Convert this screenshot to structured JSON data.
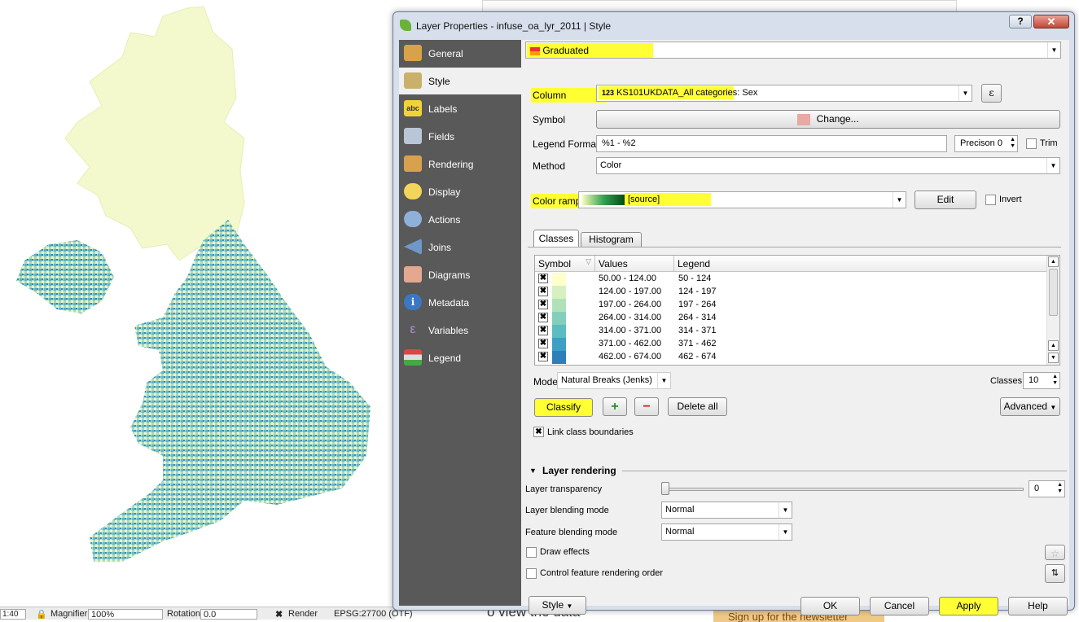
{
  "statusbar": {
    "scale_value": "1:40",
    "magnifier_label": "Magnifier",
    "magnifier_value": "100%",
    "rotation_label": "Rotation",
    "rotation_value": "0.0",
    "render_label": "Render",
    "crs": "EPSG:27700 (OTF)"
  },
  "background": {
    "text1": "o view the data",
    "text2": "Sign up for the newsletter"
  },
  "dialog": {
    "title": "Layer Properties - infuse_oa_lyr_2011 | Style",
    "help": "?",
    "close": "✕"
  },
  "sidebar": {
    "items": [
      {
        "label": "General",
        "icon": "wrench-hammer-icon",
        "color": "#d8a24a"
      },
      {
        "label": "Style",
        "icon": "paintbrush-icon",
        "color": "#c9b16b"
      },
      {
        "label": "Labels",
        "icon": "abc-label-icon",
        "color": "#f1d23a"
      },
      {
        "label": "Fields",
        "icon": "table-icon",
        "color": "#b8c6d6"
      },
      {
        "label": "Rendering",
        "icon": "brush-icon",
        "color": "#d8a14e"
      },
      {
        "label": "Display",
        "icon": "speech-bubble-icon",
        "color": "#f4d55b"
      },
      {
        "label": "Actions",
        "icon": "gear-play-icon",
        "color": "#8fb0d8"
      },
      {
        "label": "Joins",
        "icon": "join-arrow-icon",
        "color": "#6f97c9"
      },
      {
        "label": "Diagrams",
        "icon": "diagram-icon",
        "color": "#e4a78f"
      },
      {
        "label": "Metadata",
        "icon": "info-icon",
        "color": "#3a78c4"
      },
      {
        "label": "Variables",
        "icon": "epsilon-icon",
        "color": "#8b5aa5"
      },
      {
        "label": "Legend",
        "icon": "legend-icon",
        "color": "#73a93f"
      }
    ]
  },
  "style": {
    "renderer": "Graduated",
    "column_label": "Column",
    "column_value": "KS101UKDATA_All categories: Sex",
    "column_type": "123",
    "expression_btn": "ε",
    "symbol_label": "Symbol",
    "symbol_change": "Change...",
    "symbol_color": "#e8a8a4",
    "legend_format_label": "Legend Format",
    "legend_format_value": "%1 - %2",
    "precision": "Precison 0",
    "trim": "Trim",
    "method_label": "Method",
    "method_value": "Color",
    "color_ramp_label": "Color ramp",
    "color_ramp_value": "[source]",
    "edit": "Edit",
    "invert": "Invert",
    "tabs": [
      "Classes",
      "Histogram"
    ],
    "table_headers": [
      "Symbol",
      "Values",
      "Legend"
    ],
    "classes": [
      {
        "values": "50.00 - 124.00",
        "legend": "50 - 124",
        "color": "#ffffcc"
      },
      {
        "values": "124.00 - 197.00",
        "legend": "124 - 197",
        "color": "#d7f0c2"
      },
      {
        "values": "197.00 - 264.00",
        "legend": "197 - 264",
        "color": "#b2e1b9"
      },
      {
        "values": "264.00 - 314.00",
        "legend": "264 - 314",
        "color": "#83cfbb"
      },
      {
        "values": "314.00 - 371.00",
        "legend": "314 - 371",
        "color": "#5bbcc2"
      },
      {
        "values": "371.00 - 462.00",
        "legend": "371 - 462",
        "color": "#3b9fc6"
      },
      {
        "values": "462.00 - 674.00",
        "legend": "462 - 674",
        "color": "#2c7fb8"
      }
    ],
    "mode_label": "Mode",
    "mode_value": "Natural Breaks (Jenks)",
    "classes_label": "Classes",
    "classes_count": "10",
    "classify": "Classify",
    "add_icon": "+",
    "remove_icon": "−",
    "delete_all": "Delete all",
    "advanced": "Advanced",
    "link_boundaries": "Link class boundaries"
  },
  "layer_rendering": {
    "header": "Layer rendering",
    "transparency_label": "Layer transparency",
    "transparency_value": "0",
    "blending_label": "Layer blending mode",
    "blending_value": "Normal",
    "feature_blending_label": "Feature blending mode",
    "feature_blending_value": "Normal",
    "draw_effects": "Draw effects",
    "control_order": "Control feature rendering order"
  },
  "footer": {
    "style": "Style",
    "ok": "OK",
    "cancel": "Cancel",
    "apply": "Apply",
    "help": "Help"
  }
}
